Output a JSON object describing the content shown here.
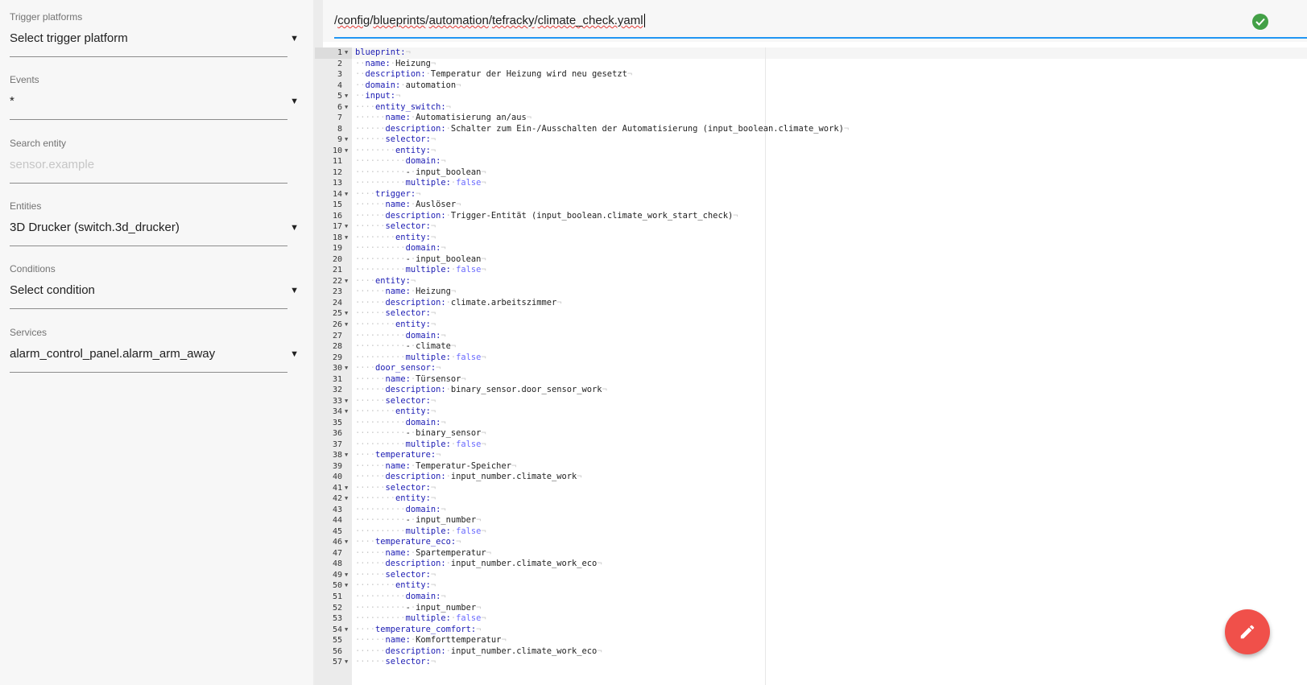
{
  "sidebar": {
    "fields": [
      {
        "label": "Trigger platforms",
        "value": "Select trigger platform",
        "placeholder": false
      },
      {
        "label": "Events",
        "value": "*",
        "placeholder": false
      },
      {
        "label": "Search entity",
        "value": "sensor.example",
        "placeholder": true
      },
      {
        "label": "Entities",
        "value": "3D Drucker (switch.3d_drucker)",
        "placeholder": false
      },
      {
        "label": "Conditions",
        "value": "Select condition",
        "placeholder": false
      },
      {
        "label": "Services",
        "value": "alarm_control_panel.alarm_arm_away",
        "placeholder": false
      }
    ]
  },
  "path_bar": {
    "segments": [
      "/",
      "config",
      "/",
      "blueprints",
      "/",
      "automation",
      "/",
      "tefracky",
      "/",
      "climate_check.yaml"
    ],
    "valid_icon": "check-circle-icon",
    "underline_color": "#2196f3"
  },
  "fab": {
    "icon": "pencil-icon",
    "color": "#f0504a"
  },
  "editor": {
    "lines": [
      {
        "n": 1,
        "indent": 0,
        "key": "blueprint:",
        "value": "",
        "fold": true
      },
      {
        "n": 2,
        "indent": 1,
        "key": "name:",
        "value": "Heizung",
        "fold": false
      },
      {
        "n": 3,
        "indent": 1,
        "key": "description:",
        "value": "Temperatur der Heizung wird neu gesetzt",
        "fold": false
      },
      {
        "n": 4,
        "indent": 1,
        "key": "domain:",
        "value": "automation",
        "fold": false
      },
      {
        "n": 5,
        "indent": 1,
        "key": "input:",
        "value": "",
        "fold": true
      },
      {
        "n": 6,
        "indent": 2,
        "key": "entity_switch:",
        "value": "",
        "fold": true
      },
      {
        "n": 7,
        "indent": 3,
        "key": "name:",
        "value": "Automatisierung an/aus",
        "fold": false
      },
      {
        "n": 8,
        "indent": 3,
        "key": "description:",
        "value": "Schalter zum Ein-/Ausschalten der Automatisierung (input_boolean.climate_work)",
        "fold": false
      },
      {
        "n": 9,
        "indent": 3,
        "key": "selector:",
        "value": "",
        "fold": true
      },
      {
        "n": 10,
        "indent": 4,
        "key": "entity:",
        "value": "",
        "fold": true
      },
      {
        "n": 11,
        "indent": 5,
        "key": "domain:",
        "value": "",
        "fold": false
      },
      {
        "n": 12,
        "indent": 5,
        "key": "-",
        "value": "input_boolean",
        "fold": false
      },
      {
        "n": 13,
        "indent": 5,
        "key": "multiple:",
        "value": "false",
        "kw": true,
        "fold": false
      },
      {
        "n": 14,
        "indent": 2,
        "key": "trigger:",
        "value": "",
        "fold": true
      },
      {
        "n": 15,
        "indent": 3,
        "key": "name:",
        "value": "Auslöser",
        "fold": false
      },
      {
        "n": 16,
        "indent": 3,
        "key": "description:",
        "value": "Trigger-Entität (input_boolean.climate_work_start_check)",
        "fold": false
      },
      {
        "n": 17,
        "indent": 3,
        "key": "selector:",
        "value": "",
        "fold": true
      },
      {
        "n": 18,
        "indent": 4,
        "key": "entity:",
        "value": "",
        "fold": true
      },
      {
        "n": 19,
        "indent": 5,
        "key": "domain:",
        "value": "",
        "fold": false
      },
      {
        "n": 20,
        "indent": 5,
        "key": "-",
        "value": "input_boolean",
        "fold": false
      },
      {
        "n": 21,
        "indent": 5,
        "key": "multiple:",
        "value": "false",
        "kw": true,
        "fold": false
      },
      {
        "n": 22,
        "indent": 2,
        "key": "entity:",
        "value": "",
        "fold": true
      },
      {
        "n": 23,
        "indent": 3,
        "key": "name:",
        "value": "Heizung",
        "fold": false
      },
      {
        "n": 24,
        "indent": 3,
        "key": "description:",
        "value": "climate.arbeitszimmer",
        "fold": false
      },
      {
        "n": 25,
        "indent": 3,
        "key": "selector:",
        "value": "",
        "fold": true
      },
      {
        "n": 26,
        "indent": 4,
        "key": "entity:",
        "value": "",
        "fold": true
      },
      {
        "n": 27,
        "indent": 5,
        "key": "domain:",
        "value": "",
        "fold": false
      },
      {
        "n": 28,
        "indent": 5,
        "key": "-",
        "value": "climate",
        "fold": false
      },
      {
        "n": 29,
        "indent": 5,
        "key": "multiple:",
        "value": "false",
        "kw": true,
        "fold": false
      },
      {
        "n": 30,
        "indent": 2,
        "key": "door_sensor:",
        "value": "",
        "fold": true
      },
      {
        "n": 31,
        "indent": 3,
        "key": "name:",
        "value": "Türsensor",
        "fold": false
      },
      {
        "n": 32,
        "indent": 3,
        "key": "description:",
        "value": "binary_sensor.door_sensor_work",
        "fold": false
      },
      {
        "n": 33,
        "indent": 3,
        "key": "selector:",
        "value": "",
        "fold": true
      },
      {
        "n": 34,
        "indent": 4,
        "key": "entity:",
        "value": "",
        "fold": true
      },
      {
        "n": 35,
        "indent": 5,
        "key": "domain:",
        "value": "",
        "fold": false
      },
      {
        "n": 36,
        "indent": 5,
        "key": "-",
        "value": "binary_sensor",
        "fold": false
      },
      {
        "n": 37,
        "indent": 5,
        "key": "multiple:",
        "value": "false",
        "kw": true,
        "fold": false
      },
      {
        "n": 38,
        "indent": 2,
        "key": "temperature:",
        "value": "",
        "fold": true
      },
      {
        "n": 39,
        "indent": 3,
        "key": "name:",
        "value": "Temperatur-Speicher",
        "fold": false
      },
      {
        "n": 40,
        "indent": 3,
        "key": "description:",
        "value": "input_number.climate_work",
        "fold": false
      },
      {
        "n": 41,
        "indent": 3,
        "key": "selector:",
        "value": "",
        "fold": true
      },
      {
        "n": 42,
        "indent": 4,
        "key": "entity:",
        "value": "",
        "fold": true
      },
      {
        "n": 43,
        "indent": 5,
        "key": "domain:",
        "value": "",
        "fold": false
      },
      {
        "n": 44,
        "indent": 5,
        "key": "-",
        "value": "input_number",
        "fold": false
      },
      {
        "n": 45,
        "indent": 5,
        "key": "multiple:",
        "value": "false",
        "kw": true,
        "fold": false
      },
      {
        "n": 46,
        "indent": 2,
        "key": "temperature_eco:",
        "value": "",
        "fold": true
      },
      {
        "n": 47,
        "indent": 3,
        "key": "name:",
        "value": "Spartemperatur",
        "fold": false
      },
      {
        "n": 48,
        "indent": 3,
        "key": "description:",
        "value": "input_number.climate_work_eco",
        "fold": false
      },
      {
        "n": 49,
        "indent": 3,
        "key": "selector:",
        "value": "",
        "fold": true
      },
      {
        "n": 50,
        "indent": 4,
        "key": "entity:",
        "value": "",
        "fold": true
      },
      {
        "n": 51,
        "indent": 5,
        "key": "domain:",
        "value": "",
        "fold": false
      },
      {
        "n": 52,
        "indent": 5,
        "key": "-",
        "value": "input_number",
        "fold": false
      },
      {
        "n": 53,
        "indent": 5,
        "key": "multiple:",
        "value": "false",
        "kw": true,
        "fold": false
      },
      {
        "n": 54,
        "indent": 2,
        "key": "temperature_comfort:",
        "value": "",
        "fold": true
      },
      {
        "n": 55,
        "indent": 3,
        "key": "name:",
        "value": "Komforttemperatur",
        "fold": false
      },
      {
        "n": 56,
        "indent": 3,
        "key": "description:",
        "value": "input_number.climate_work_eco",
        "fold": false
      },
      {
        "n": 57,
        "indent": 3,
        "key": "selector:",
        "value": "",
        "fold": true
      }
    ]
  }
}
